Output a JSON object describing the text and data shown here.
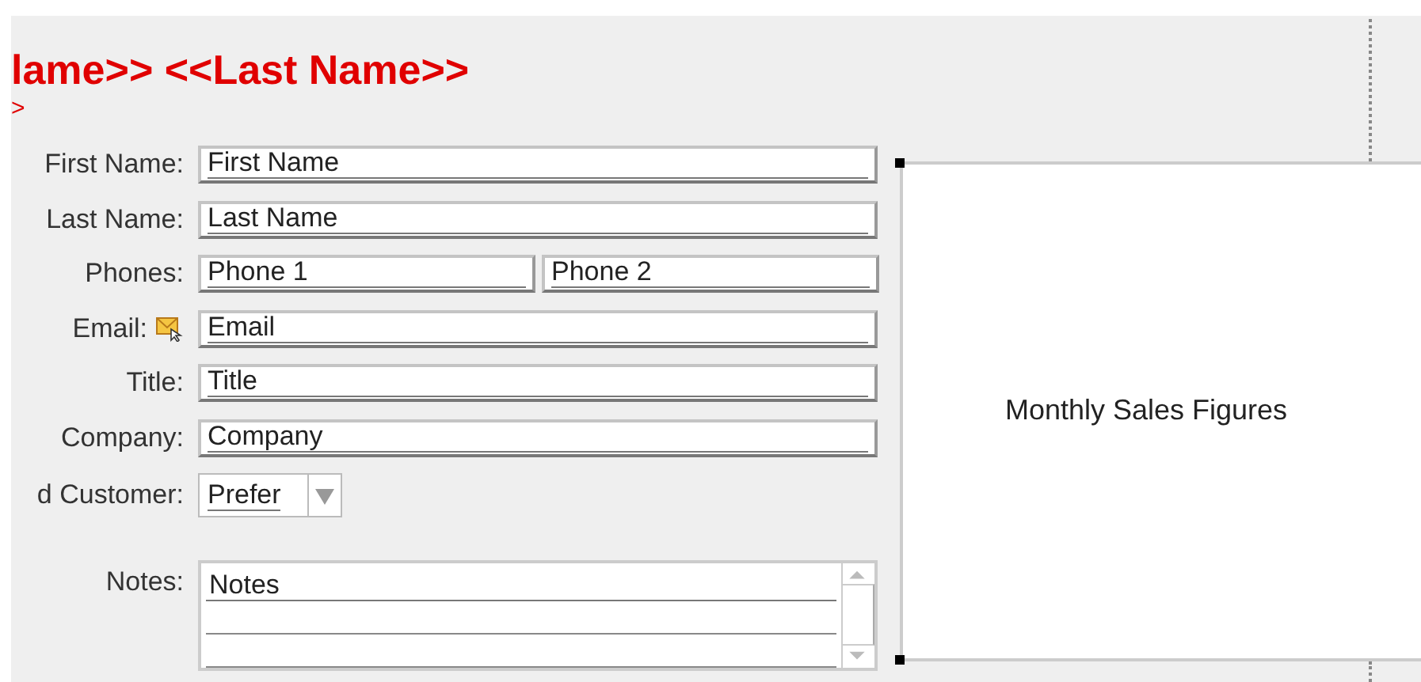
{
  "header": {
    "title": "lame>> <<Last Name>>",
    "subtitle": ">"
  },
  "fields": [
    {
      "kind": "text",
      "label": "First Name:",
      "value": "First Name"
    },
    {
      "kind": "text",
      "label": "Last Name:",
      "value": "Last Name"
    },
    {
      "kind": "pair",
      "label": "Phones:",
      "values": [
        "Phone 1",
        "Phone 2"
      ]
    },
    {
      "kind": "email",
      "label": "Email:",
      "value": "Email"
    },
    {
      "kind": "text",
      "label": "Title:",
      "value": "Title"
    },
    {
      "kind": "text",
      "label": "Company:",
      "value": "Company"
    },
    {
      "kind": "combo",
      "label": "d Customer:",
      "value": "Prefer"
    },
    {
      "kind": "memo",
      "label": "Notes:",
      "value": "Notes"
    }
  ],
  "chart_placeholder": {
    "caption": "Monthly Sales Figures"
  }
}
